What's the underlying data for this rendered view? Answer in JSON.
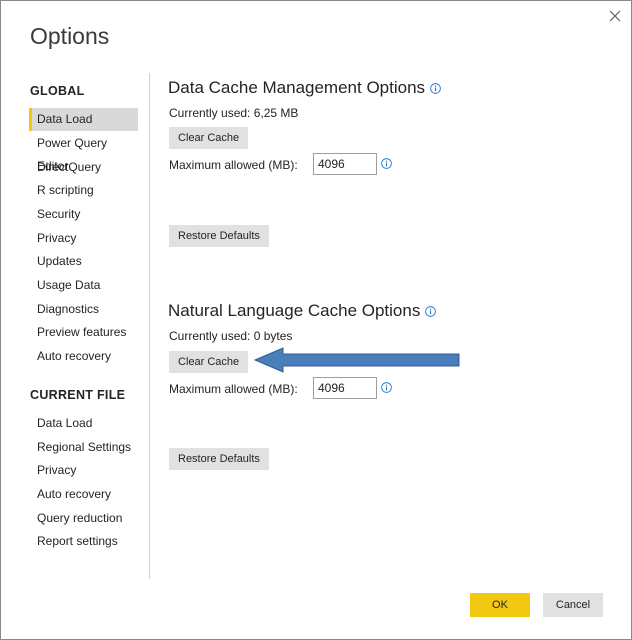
{
  "window": {
    "title": "Options"
  },
  "sidebar": {
    "global_heading": "GLOBAL",
    "global_items": [
      {
        "label": "Data Load",
        "selected": true
      },
      {
        "label": "Power Query Editor"
      },
      {
        "label": "DirectQuery"
      },
      {
        "label": "R scripting"
      },
      {
        "label": "Security"
      },
      {
        "label": "Privacy"
      },
      {
        "label": "Updates"
      },
      {
        "label": "Usage Data"
      },
      {
        "label": "Diagnostics"
      },
      {
        "label": "Preview features"
      },
      {
        "label": "Auto recovery"
      }
    ],
    "current_file_heading": "CURRENT FILE",
    "current_file_items": [
      {
        "label": "Data Load"
      },
      {
        "label": "Regional Settings"
      },
      {
        "label": "Privacy"
      },
      {
        "label": "Auto recovery"
      },
      {
        "label": "Query reduction"
      },
      {
        "label": "Report settings"
      }
    ]
  },
  "data_cache": {
    "heading": "Data Cache Management Options",
    "currently_used": "Currently used: 6,25 MB",
    "clear_label": "Clear Cache",
    "max_label": "Maximum allowed (MB):",
    "max_value": "4096",
    "restore_label": "Restore Defaults"
  },
  "nl_cache": {
    "heading": "Natural Language Cache Options",
    "currently_used": "Currently used: 0 bytes",
    "clear_label": "Clear Cache",
    "max_label": "Maximum allowed (MB):",
    "max_value": "4096",
    "restore_label": "Restore Defaults"
  },
  "footer": {
    "ok_label": "OK",
    "cancel_label": "Cancel"
  },
  "colors": {
    "accent": "#f2c811",
    "info": "#2b79d0",
    "arrow": "#4a7ebb",
    "selected_bg": "#d9d9d9"
  },
  "icons": {
    "close": "close-icon",
    "info": "info-icon",
    "annotation": "arrow-annotation"
  }
}
